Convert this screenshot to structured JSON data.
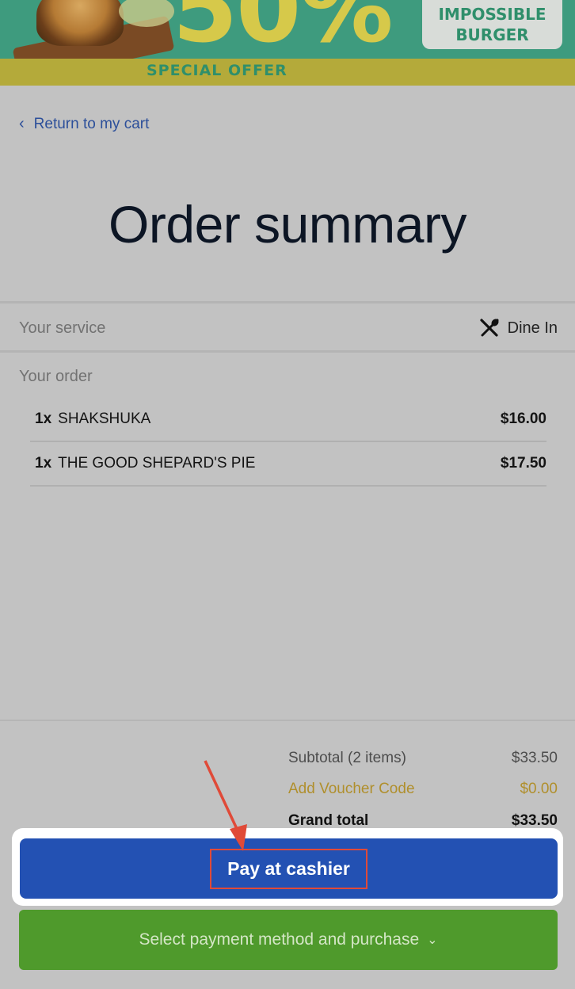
{
  "banner": {
    "percent_text": "50%",
    "special_offer": "SPECIAL OFFER",
    "badge_line1": "IMPOSSIBLE",
    "badge_line2": "BURGER"
  },
  "nav": {
    "return_label": "Return to my cart",
    "return_icon": "chevron-left-icon"
  },
  "page_title": "Order summary",
  "service": {
    "label": "Your service",
    "value": "Dine In",
    "icon": "utensils-icon"
  },
  "order": {
    "label": "Your order",
    "items": [
      {
        "qty": "1x",
        "name": "SHAKSHUKA",
        "price": "$16.00"
      },
      {
        "qty": "1x",
        "name": "THE GOOD SHEPARD'S PIE",
        "price": "$17.50"
      }
    ]
  },
  "totals": {
    "subtotal_label": "Subtotal (2 items)",
    "subtotal_value": "$33.50",
    "voucher_label": "Add Voucher Code",
    "voucher_value": "$0.00",
    "grand_label": "Grand total",
    "grand_value": "$33.50"
  },
  "actions": {
    "pay_cashier_label": "Pay at cashier",
    "purchase_label": "Select payment method and purchase",
    "purchase_icon": "chevron-down-icon"
  },
  "colors": {
    "pay_button": "#2351b3",
    "purchase_button": "#4f9a2c",
    "voucher_text": "#b08f2c",
    "annotation": "#e04a38",
    "link": "#2c4f9a"
  }
}
